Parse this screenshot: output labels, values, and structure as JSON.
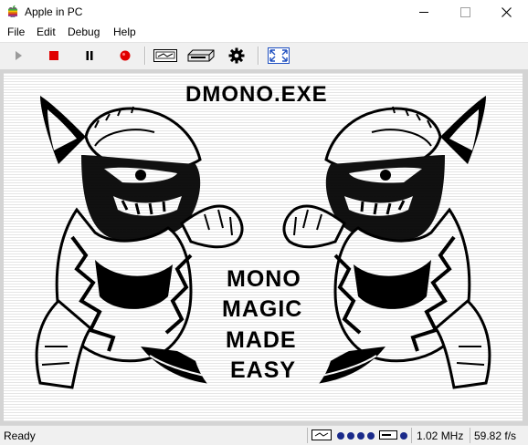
{
  "window": {
    "title": "Apple in PC",
    "minimize_glyph": "—",
    "maximize_glyph": "☐",
    "close_glyph": "✕"
  },
  "menu": [
    "File",
    "Edit",
    "Debug",
    "Help"
  ],
  "toolbar": {
    "buttons": [
      {
        "name": "run",
        "icon": "play-icon"
      },
      {
        "name": "stop",
        "icon": "stop-icon"
      },
      {
        "name": "pause",
        "icon": "pause-icon"
      },
      {
        "name": "record",
        "icon": "record-icon"
      },
      {
        "name": "cassette",
        "icon": "cassette-icon"
      },
      {
        "name": "disk-drive",
        "icon": "disk-drive-icon"
      },
      {
        "name": "settings",
        "icon": "gear-icon"
      },
      {
        "name": "fullscreen",
        "icon": "fullscreen-icon"
      }
    ]
  },
  "screen": {
    "heading": "DMONO.EXE",
    "lines": [
      "MONO",
      "MAGIC",
      "MADE",
      "EASY"
    ]
  },
  "status": {
    "ready": "Ready",
    "clock": "1.02 MHz",
    "fps": "59.82 f/s",
    "drive_leds": 4
  },
  "colors": {
    "stop": "#e00000",
    "record": "#e00000",
    "led": "#1a2a8a",
    "fullscreen": "#2050c0"
  }
}
